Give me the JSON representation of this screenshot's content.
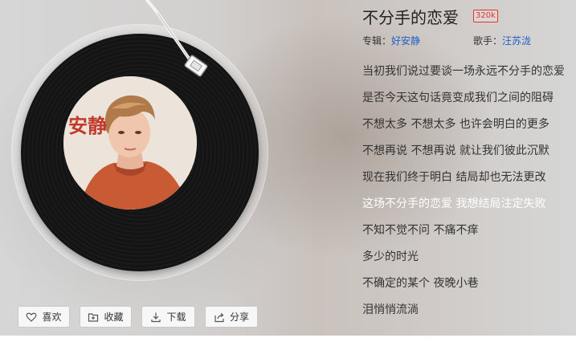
{
  "song": {
    "title": "不分手的恋爱",
    "quality": "320k",
    "album_label": "专辑：",
    "album": "好安静",
    "singer_label": "歌手：",
    "singer": "汪苏泷"
  },
  "cover": {
    "text": "安静"
  },
  "actions": [
    {
      "label": "喜欢",
      "icon": "heart-icon"
    },
    {
      "label": "收藏",
      "icon": "add-folder-icon"
    },
    {
      "label": "下载",
      "icon": "download-icon"
    },
    {
      "label": "分享",
      "icon": "share-icon"
    }
  ],
  "lyrics": [
    "当初我们说过要谈一场永远不分手的恋爱",
    "是否今天这句话竟变成我们之间的阻碍",
    "不想太多 不想太多 也许会明白的更多",
    "不想再说 不想再说 就让我们彼此沉默",
    "现在我们终于明白 结局却也无法更改",
    "这场不分手的恋爱 我想结局注定失败",
    "不知不觉不问 不痛不痒",
    "多少的时光",
    "不确定的某个 夜晚小巷",
    "泪悄悄流淌"
  ],
  "current_lyric_index": 5,
  "colors": {
    "accent_red": "#e83030",
    "link_blue": "#1f5fc6",
    "current_lyric": "#ffffff"
  }
}
